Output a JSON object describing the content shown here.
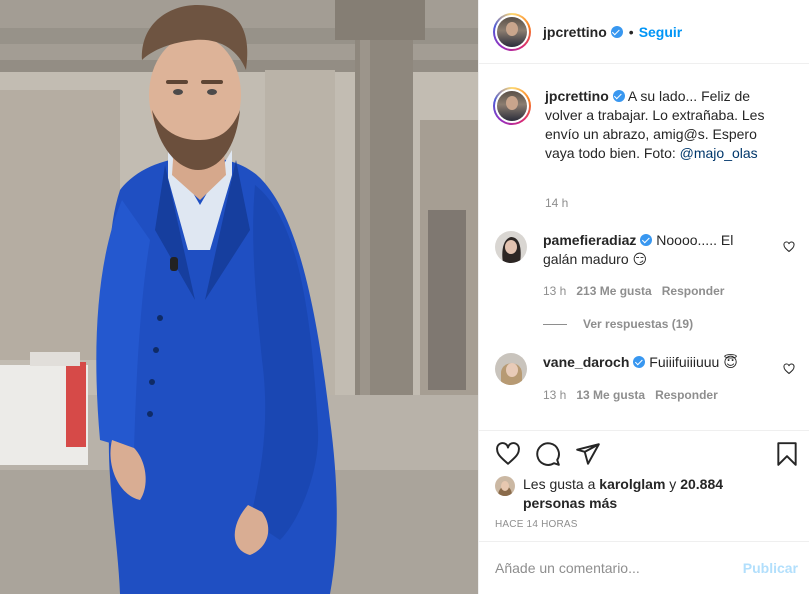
{
  "post": {
    "author": "jpcrettino",
    "follow_label": "Seguir",
    "separator": "•"
  },
  "caption": {
    "author": "jpcrettino",
    "text": "A su lado... Feliz de volver a trabajar. Lo extrañaba. Les envío un abrazo, amig@s. Espero vaya todo bien. Foto: ",
    "mention": "@majo_olas",
    "time": "14 h"
  },
  "comments": [
    {
      "author": "pamefieradiaz",
      "text": "Noooo..... El galán maduro",
      "emoji": "😏",
      "time": "13 h",
      "likes": "213 Me gusta",
      "reply_label": "Responder",
      "view_replies": "Ver respuestas (19)"
    },
    {
      "author": "vane_daroch",
      "text": "Fuiiifuiiiuuu",
      "emoji": "😇",
      "time": "13 h",
      "likes": "13 Me gusta",
      "reply_label": "Responder"
    }
  ],
  "likes": {
    "prefix": "Les gusta a ",
    "user": "karolglam",
    "suffix": " y",
    "count": "20.884 personas más"
  },
  "time_ago": "HACE 14 HORAS",
  "add_comment": {
    "placeholder": "Añade un comentario...",
    "publish_label": "Publicar"
  },
  "icons": {
    "like": "heart-icon",
    "comment": "comment-icon",
    "share": "share-icon",
    "save": "bookmark-icon"
  },
  "colors": {
    "follow": "#0095f6",
    "verified": "#3897f0",
    "publish_disabled": "#b2dffc",
    "suit": "#1c4fc0"
  }
}
